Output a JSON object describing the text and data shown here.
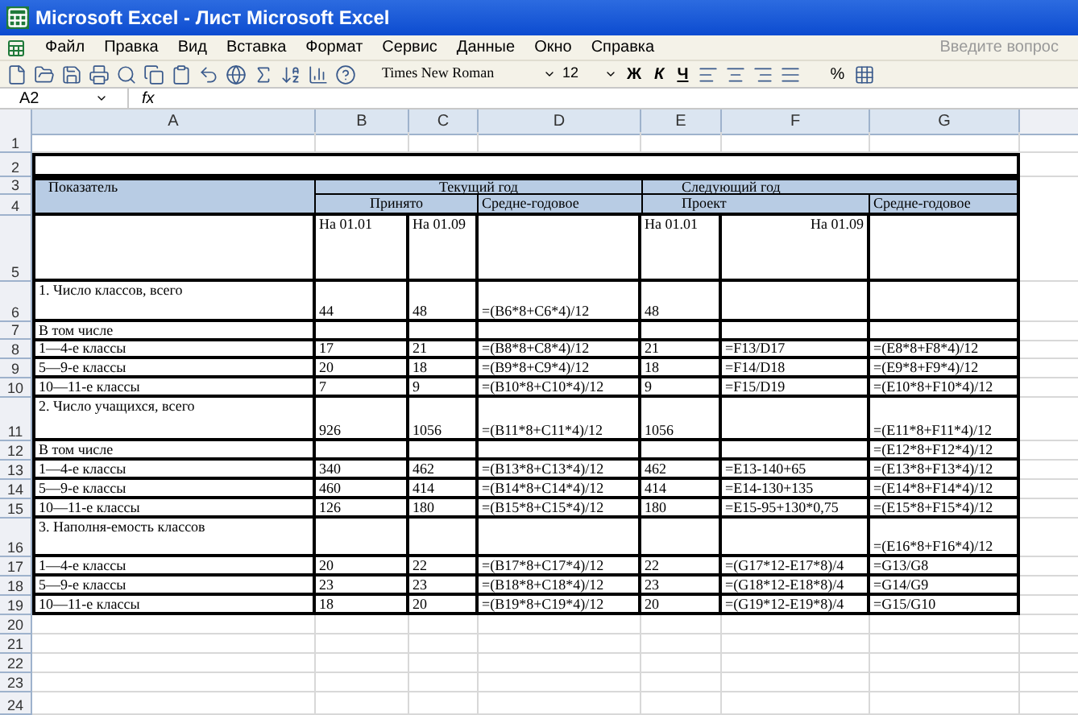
{
  "window": {
    "title": "Microsoft Excel - Лист Microsoft Excel"
  },
  "menu": [
    "Файл",
    "Правка",
    "Вид",
    "Вставка",
    "Формат",
    "Сервис",
    "Данные",
    "Окно",
    "Справка"
  ],
  "help_placeholder": "Введите вопрос",
  "toolbar": {
    "font": "Times New Roman",
    "size": "12",
    "bold": "Ж",
    "italic": "К",
    "underline": "Ч",
    "percent": "%"
  },
  "formula_bar": {
    "name_box": "A2",
    "fx": "fx"
  },
  "columns": [
    "A",
    "B",
    "C",
    "D",
    "E",
    "F",
    "G"
  ],
  "header": {
    "rows": [
      "3",
      "4"
    ],
    "indicator": "Показатель",
    "current_year": "Текущий год",
    "next_year": "Следующий год",
    "accepted": "Принято",
    "current_avg": "Средне-годовое",
    "project": "Проект",
    "next_avg": "Средне-годовое"
  },
  "rows": [
    {
      "number": "1",
      "kind": "blank",
      "cells": {}
    },
    {
      "number": "2",
      "kind": "selected",
      "cells": {}
    },
    {
      "number": "5",
      "kind": "labels",
      "cells": {
        "b": "На 01.01",
        "c": "На 01.09",
        "e": "На 01.01",
        "f": "На 01.09"
      }
    },
    {
      "number": "6",
      "kind": "table",
      "cells": {
        "a": "1. Число классов, всего",
        "b": "44",
        "c": "48",
        "d": "=(B6*8+C6*4)/12",
        "e": "48"
      }
    },
    {
      "number": "7",
      "kind": "table",
      "cells": {
        "a": "В том числе"
      }
    },
    {
      "number": "8",
      "kind": "table",
      "cells": {
        "a": "1—4-е классы",
        "b": "17",
        "c": "21",
        "d": "=(B8*8+C8*4)/12",
        "e": "21",
        "f": "=F13/D17",
        "g": "=(E8*8+F8*4)/12"
      }
    },
    {
      "number": "9",
      "kind": "table",
      "cells": {
        "a": "5—9-е классы",
        "b": "20",
        "c": "18",
        "d": "=(B9*8+C9*4)/12",
        "e": "18",
        "f": "=F14/D18",
        "g": "=(E9*8+F9*4)/12"
      }
    },
    {
      "number": "10",
      "kind": "table",
      "cells": {
        "a": "10—11-е классы",
        "b": "7",
        "c": "9",
        "d": "=(B10*8+C10*4)/12",
        "e": "9",
        "f": "=F15/D19",
        "g": "=(E10*8+F10*4)/12"
      }
    },
    {
      "number": "11",
      "kind": "table",
      "cells": {
        "a": "2. Число учащихся, всего",
        "b": "926",
        "c": "1056",
        "d": "=(B11*8+C11*4)/12",
        "e": "1056",
        "g": "=(E11*8+F11*4)/12"
      }
    },
    {
      "number": "12",
      "kind": "table",
      "cells": {
        "a": "В том числе",
        "g": "=(E12*8+F12*4)/12"
      }
    },
    {
      "number": "13",
      "kind": "table",
      "cells": {
        "a": "1—4-е классы",
        "b": "340",
        "c": "462",
        "d": "=(B13*8+C13*4)/12",
        "e": "462",
        "f": "=E13-140+65",
        "g": "=(E13*8+F13*4)/12"
      }
    },
    {
      "number": "14",
      "kind": "table",
      "cells": {
        "a": "5—9-е классы",
        "b": "460",
        "c": "414",
        "d": "=(B14*8+C14*4)/12",
        "e": "414",
        "f": "=E14-130+135",
        "g": "=(E14*8+F14*4)/12"
      }
    },
    {
      "number": "15",
      "kind": "table",
      "cells": {
        "a": "10—11-е классы",
        "b": "126",
        "c": "180",
        "d": "=(B15*8+C15*4)/12",
        "e": "180",
        "f": "=E15-95+130*0,75",
        "g": "=(E15*8+F15*4)/12"
      }
    },
    {
      "number": "16",
      "kind": "table",
      "cells": {
        "a": "3. Наполня-емость классов",
        "g": "=(E16*8+F16*4)/12"
      }
    },
    {
      "number": "17",
      "kind": "table",
      "cells": {
        "a": "1—4-е классы",
        "b": "20",
        "c": "22",
        "d": "=(B17*8+C17*4)/12",
        "e": "22",
        "f": "=(G17*12-E17*8)/4",
        "g": "=G13/G8"
      }
    },
    {
      "number": "18",
      "kind": "table",
      "cells": {
        "a": "5—9-е классы",
        "b": "23",
        "c": "23",
        "d": "=(B18*8+C18*4)/12",
        "e": "23",
        "f": "=(G18*12-E18*8)/4",
        "g": "=G14/G9"
      }
    },
    {
      "number": "19",
      "kind": "table",
      "cells": {
        "a": "10—11-е классы",
        "b": "18",
        "c": "20",
        "d": "=(B19*8+C19*4)/12",
        "e": "20",
        "f": "=(G19*12-E19*8)/4",
        "g": "=G15/G10"
      }
    },
    {
      "number": "20",
      "kind": "blank",
      "cells": {}
    },
    {
      "number": "21",
      "kind": "blank",
      "cells": {}
    },
    {
      "number": "22",
      "kind": "blank",
      "cells": {}
    },
    {
      "number": "23",
      "kind": "blank",
      "cells": {}
    },
    {
      "number": "24",
      "kind": "blank",
      "cells": {}
    }
  ]
}
